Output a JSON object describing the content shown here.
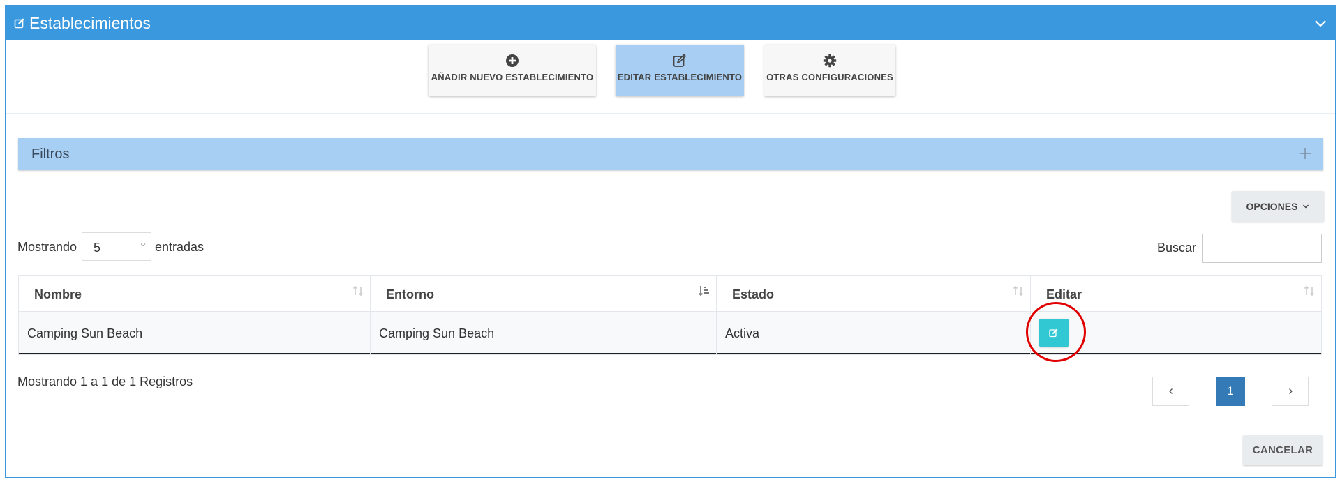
{
  "header": {
    "title": "Establecimientos"
  },
  "toolbar": {
    "add_label": "AÑADIR NUEVO ESTABLECIMIENTO",
    "edit_label": "EDITAR ESTABLECIMIENTO",
    "other_label": "OTRAS CONFIGURACIONES"
  },
  "filters": {
    "label": "Filtros"
  },
  "options": {
    "label": "OPCIONES"
  },
  "length": {
    "prefix": "Mostrando",
    "value": "5",
    "suffix": "entradas"
  },
  "search": {
    "label": "Buscar",
    "value": ""
  },
  "table": {
    "columns": [
      "Nombre",
      "Entorno",
      "Estado",
      "Editar"
    ],
    "rows": [
      {
        "nombre": "Camping Sun Beach",
        "entorno": "Camping Sun Beach",
        "estado": "Activa"
      }
    ]
  },
  "footer": {
    "records": "Mostrando 1 a 1 de 1 Registros",
    "current_page": "1",
    "cancel_label": "CANCELAR"
  },
  "colors": {
    "header": "#3a99de",
    "filters": "#a7cef3",
    "edit_button": "#31c8d4",
    "active_page": "#337ab7",
    "highlight": "#e00000"
  }
}
